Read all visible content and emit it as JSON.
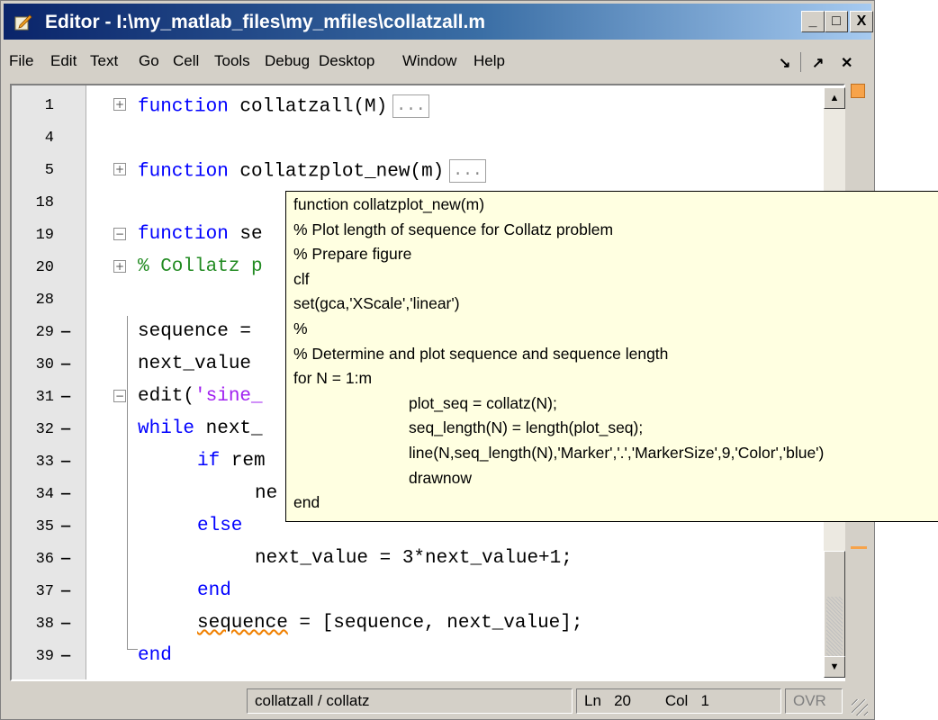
{
  "window": {
    "title": "Editor - I:\\my_matlab_files\\my_mfiles\\collatzall.m",
    "caption_buttons": [
      "_",
      "□",
      "X"
    ]
  },
  "menu": [
    "File",
    "Edit",
    "Text",
    "Go",
    "Cell",
    "Tools",
    "Debug",
    "Desktop",
    "Window",
    "Help"
  ],
  "menu_right": [
    "↘",
    "↗",
    "✕"
  ],
  "gutter": [
    {
      "n": "1",
      "dash": false
    },
    {
      "n": "4",
      "dash": false
    },
    {
      "n": "5",
      "dash": false
    },
    {
      "n": "18",
      "dash": false
    },
    {
      "n": "19",
      "dash": false
    },
    {
      "n": "20",
      "dash": false
    },
    {
      "n": "28",
      "dash": false
    },
    {
      "n": "29",
      "dash": true
    },
    {
      "n": "30",
      "dash": true
    },
    {
      "n": "31",
      "dash": true
    },
    {
      "n": "32",
      "dash": true
    },
    {
      "n": "33",
      "dash": true
    },
    {
      "n": "34",
      "dash": true
    },
    {
      "n": "35",
      "dash": true
    },
    {
      "n": "36",
      "dash": true
    },
    {
      "n": "37",
      "dash": true
    },
    {
      "n": "38",
      "dash": true
    },
    {
      "n": "39",
      "dash": true
    }
  ],
  "code": {
    "l1_kw": "function",
    "l1_rest": " collatzall(M)",
    "l5_kw": "function",
    "l5_rest": " collatzplot_new(m)",
    "l19_kw": "function",
    "l19_rest": " se",
    "l20_cm": "% Collatz p",
    "l29": "sequence = ",
    "l30": "next_value ",
    "l31_pre": "edit(",
    "l31_str": "'sine_",
    "l32_kw": "while",
    "l32_rest": " next_",
    "l33_kw": "if",
    "l33_rest": " rem",
    "l34": "ne",
    "l35_kw": "else",
    "l36": "next_value = 3*next_value+1;",
    "l37_kw": "end",
    "l38_a": "sequence",
    "l38_b": " = [sequence, next_value];",
    "l39_kw": "end",
    "ellipsis": "..."
  },
  "tooltip": [
    "function collatzplot_new(m)",
    "% Plot length of sequence for Collatz problem",
    "% Prepare figure",
    "clf",
    "set(gca,'XScale','linear')",
    "%",
    "% Determine and plot sequence and sequence length",
    "for N = 1:m",
    "plot_seq = collatz(N);",
    "seq_length(N) = length(plot_seq);",
    "line(N,seq_length(N),'Marker','.','MarkerSize',9,'Color','blue')",
    "drawnow",
    "end"
  ],
  "status": {
    "context": "collatzall / collatz",
    "ln_label": "Ln",
    "ln_value": "20",
    "col_label": "Col",
    "col_value": "1",
    "ovr": "OVR"
  },
  "colors": {
    "keyword": "#0000ff",
    "comment": "#228b22",
    "string": "#a020f0",
    "tooltip_bg": "#ffffe1",
    "mlint_warning": "#f7a34a"
  }
}
